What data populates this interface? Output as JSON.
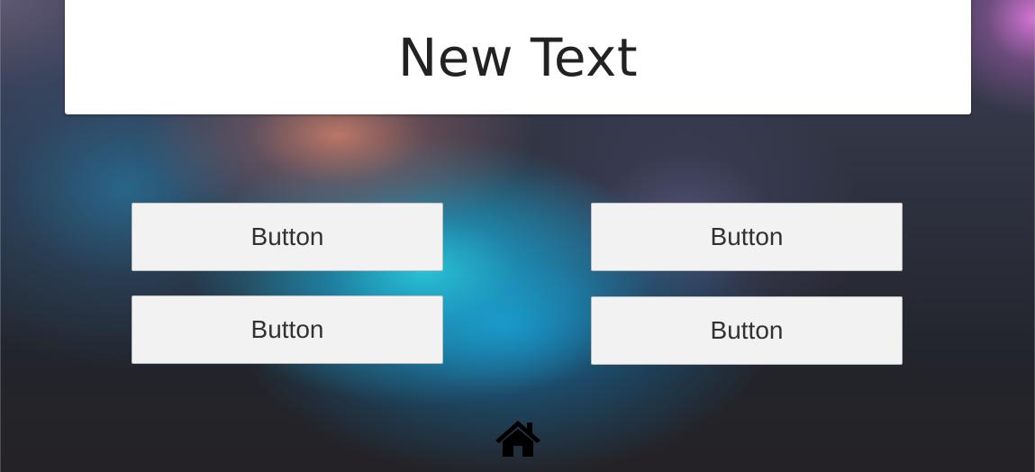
{
  "title": {
    "text": "New Text"
  },
  "buttons": [
    {
      "label": "Button"
    },
    {
      "label": "Button"
    },
    {
      "label": "Button"
    },
    {
      "label": "Button"
    }
  ],
  "icons": {
    "home": "home-icon"
  },
  "colors": {
    "panel_background": "#ffffff",
    "button_background": "#f2f2f2",
    "button_text": "#323232",
    "title_text": "#222222",
    "icon": "#000000"
  }
}
